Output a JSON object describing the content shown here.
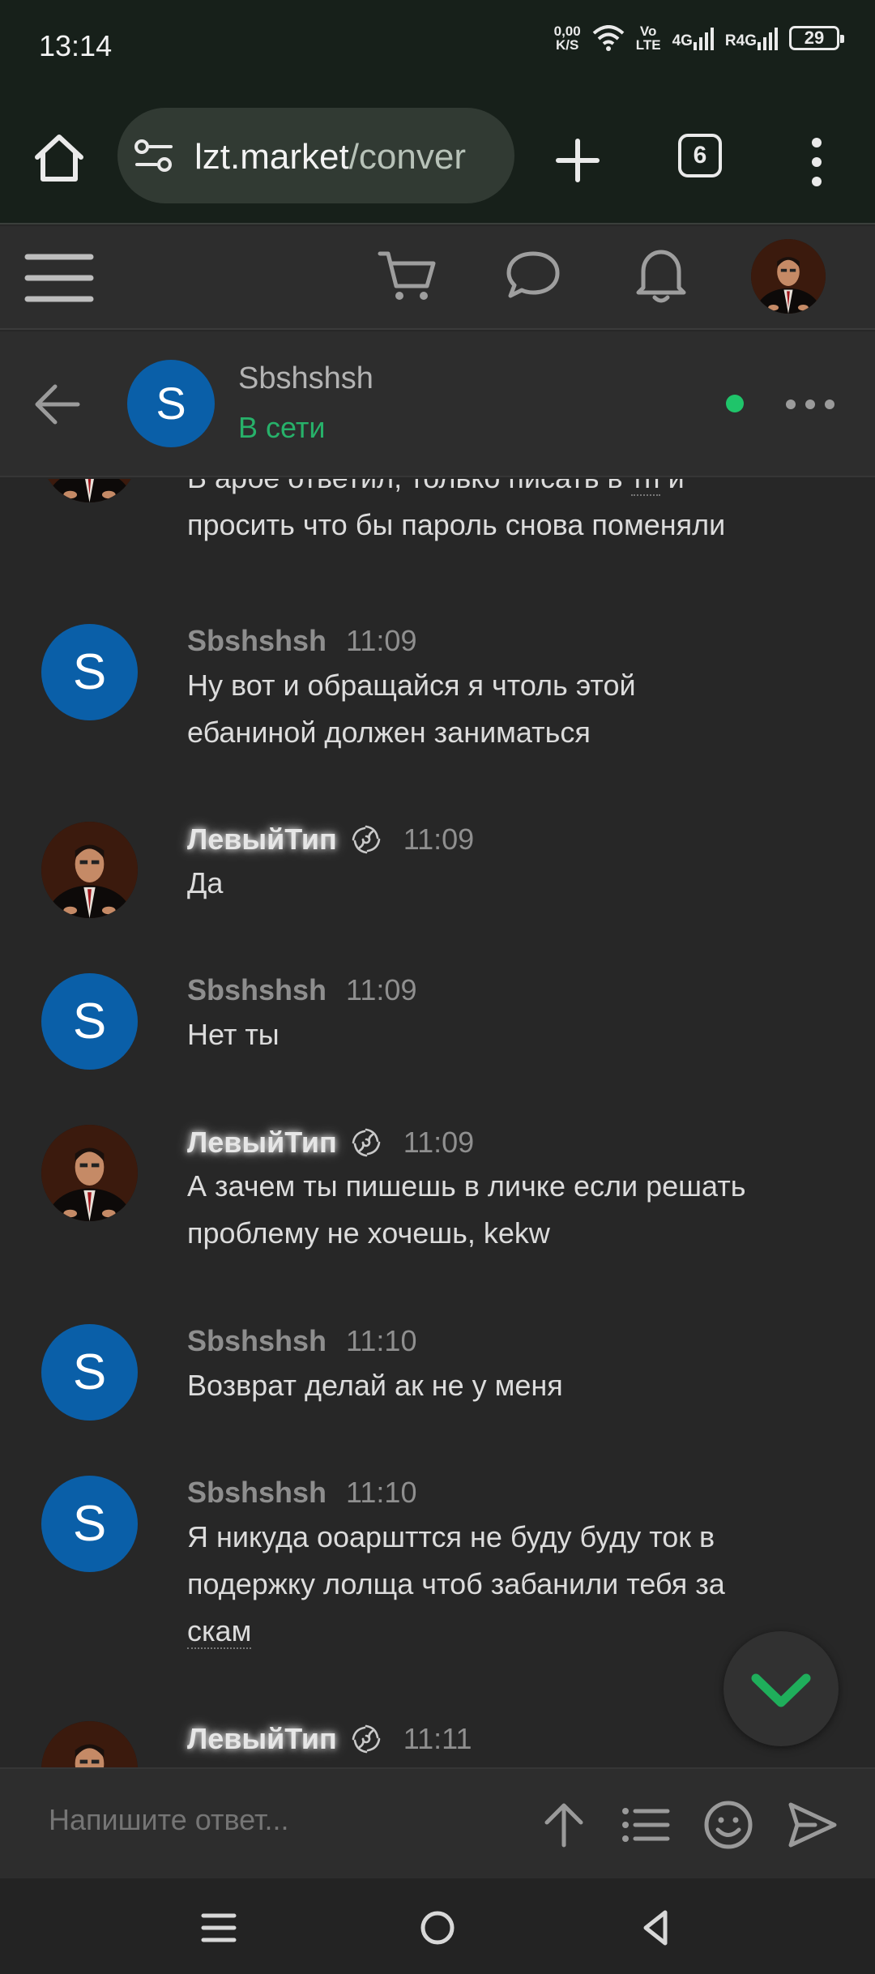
{
  "status_bar": {
    "time": "13:14",
    "net_speed_top": "0,00",
    "net_speed_bottom": "K/S",
    "volte_top": "Vo",
    "volte_bottom": "LTE",
    "signal1_label": "4G",
    "signal2_label": "R4G",
    "battery": "29"
  },
  "browser": {
    "url_host": "lzt.market",
    "url_path": "/conver",
    "tab_count": "6"
  },
  "conversation": {
    "initial": "S",
    "name": "Sbshshsh",
    "status": "В сети"
  },
  "messages": [
    {
      "type": "partial",
      "line1_pre": "В арбе ответил, только писать в ",
      "line1_dotted": "тп",
      "line1_post": " и",
      "line2": "просить что бы пароль снова поменяли"
    },
    {
      "author": "Sbshshsh",
      "time": "11:09",
      "lines": [
        "Ну вот и обращайся я чтоль этой",
        "ебаниной должен заниматься"
      ]
    },
    {
      "author": "ЛевыйТип",
      "time": "11:09",
      "lines": [
        "Да"
      ]
    },
    {
      "author": "Sbshshsh",
      "time": "11:09",
      "lines": [
        "Нет ты"
      ]
    },
    {
      "author": "ЛевыйТип",
      "time": "11:09",
      "lines": [
        "А зачем ты пишешь в личке если решать",
        "проблему не хочешь, kekw"
      ]
    },
    {
      "author": "Sbshshsh",
      "time": "11:10",
      "lines": [
        "Возврат делай ак не у меня"
      ]
    },
    {
      "author": "Sbshshsh",
      "time": "11:10",
      "lines": [
        "Я никуда ооаршттся не буду буду ток в",
        "подержку лолща чтоб забанили тебя за"
      ],
      "dotted_word": "скам"
    },
    {
      "author": "ЛевыйТип",
      "time": "11:11",
      "lines": []
    }
  ],
  "composer": {
    "placeholder": "Напишите ответ..."
  },
  "colors": {
    "accent_green": "#27b16a",
    "avatar_blue": "#0a5fa8",
    "background": "#272727"
  },
  "icons": [
    "home-icon",
    "site-settings-icon",
    "plus-icon",
    "tabs-icon",
    "more-vertical-icon",
    "menu-icon",
    "cart-icon",
    "chat-icon",
    "bell-icon",
    "back-arrow-icon",
    "more-horizontal-icon",
    "spiral-icon",
    "chevron-down-icon",
    "arrow-up-icon",
    "list-icon",
    "smiley-icon",
    "send-icon"
  ]
}
